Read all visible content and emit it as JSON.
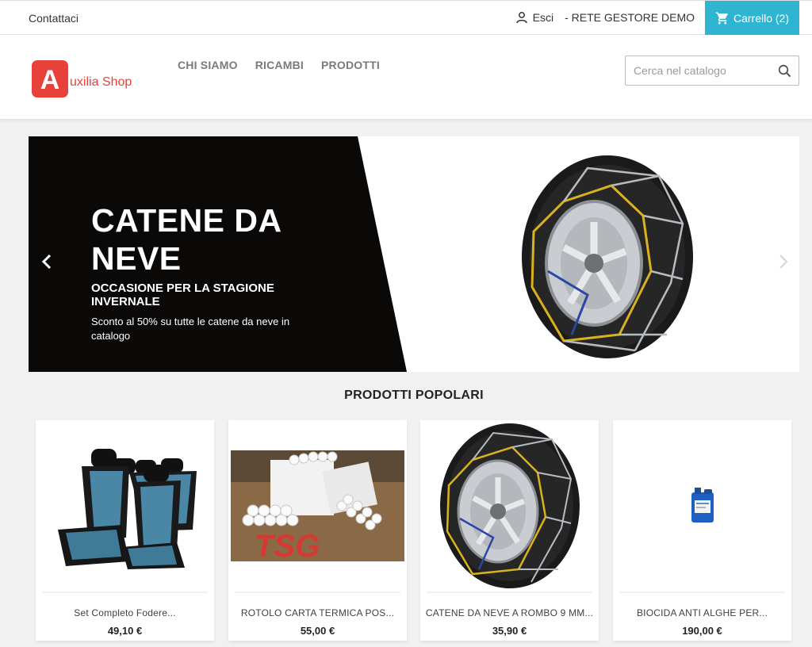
{
  "topbar": {
    "contact_label": "Contattaci",
    "logout_label": "Esci",
    "user_label": "- RETE GESTORE DEMO",
    "cart_label": "Carrello (2)"
  },
  "header": {
    "logo_letter": "A",
    "logo_text": "uxilia Shop",
    "nav": [
      {
        "label": "CHI SIAMO"
      },
      {
        "label": "RICAMBI"
      },
      {
        "label": "PRODOTTI"
      }
    ],
    "search_placeholder": "Cerca nel catalogo"
  },
  "banner": {
    "title": "CATENE DA NEVE",
    "subtitle": "OCCASIONE PER LA STAGIONE INVERNALE",
    "description": "Sconto al 50% su tutte le catene da neve in catalogo"
  },
  "products_section": {
    "title": "PRODOTTI POPOLARI",
    "items": [
      {
        "name": "Set Completo Fodere...",
        "price": "49,10 €"
      },
      {
        "name": "ROTOLO CARTA TERMICA POS...",
        "price": "55,00 €"
      },
      {
        "name": "CATENE DA NEVE A ROMBO 9 MM...",
        "price": "35,90 €"
      },
      {
        "name": "BIOCIDA ANTI ALGHE PER...",
        "price": "190,00 €"
      }
    ]
  },
  "colors": {
    "accent": "#2fb5d2",
    "brand": "#e8413a",
    "banner_dark": "#0b0808"
  }
}
